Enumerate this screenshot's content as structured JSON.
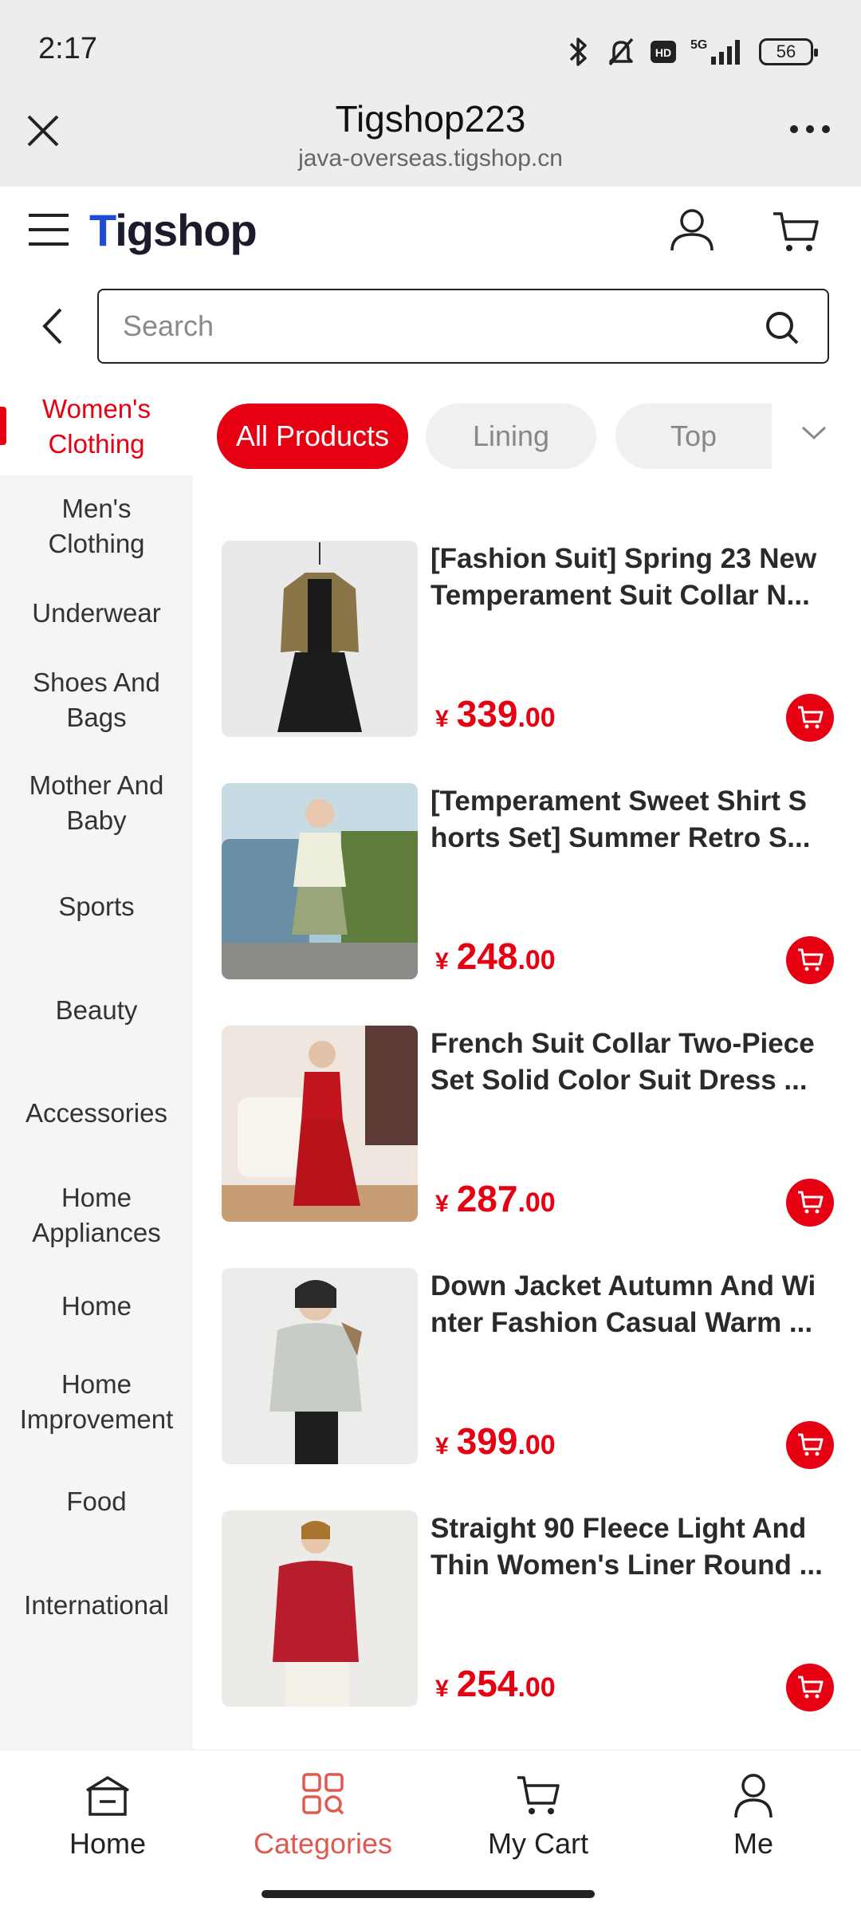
{
  "status_bar": {
    "time": "2:17",
    "network": "5G",
    "hd_badge": "HD",
    "battery": "56",
    "icons": [
      "bluetooth-icon",
      "mute-icon",
      "hd-icon",
      "signal-icon",
      "battery-icon"
    ]
  },
  "browser": {
    "title": "Tigshop223",
    "url": "java-overseas.tigshop.cn"
  },
  "header": {
    "logo": "Tigshop"
  },
  "search": {
    "placeholder": "Search"
  },
  "sidebar": {
    "items": [
      {
        "label": "Women's\nClothing",
        "active": true
      },
      {
        "label": "Men's\nClothing"
      },
      {
        "label": "Underwear"
      },
      {
        "label": "Shoes And\nBags"
      },
      {
        "label": "Mother And\nBaby"
      },
      {
        "label": "Sports"
      },
      {
        "label": "Beauty"
      },
      {
        "label": "Accessories"
      },
      {
        "label": "Home\nAppliances"
      },
      {
        "label": "Home"
      },
      {
        "label": "Home\nImprovement"
      },
      {
        "label": "Food"
      },
      {
        "label": "International"
      }
    ]
  },
  "filters": {
    "chips": [
      "All Products",
      "Lining",
      "Top"
    ],
    "active": "All Products"
  },
  "products": [
    {
      "title": "[Fashion Suit] Spring 23 New Temperament Suit Collar N...",
      "currency": "¥",
      "price_int": "339",
      "price_dec": ".00"
    },
    {
      "title": "[Temperament Sweet Shirt S horts Set] Summer Retro S...",
      "currency": "¥",
      "price_int": "248",
      "price_dec": ".00"
    },
    {
      "title": "French Suit Collar Two-Piece Set Solid Color Suit Dress ...",
      "currency": "¥",
      "price_int": "287",
      "price_dec": ".00"
    },
    {
      "title": "Down Jacket Autumn And Wi nter Fashion Casual Warm ...",
      "currency": "¥",
      "price_int": "399",
      "price_dec": ".00"
    },
    {
      "title": "Straight 90 Fleece Light And Thin Women's Liner Round ...",
      "currency": "¥",
      "price_int": "254",
      "price_dec": ".00"
    }
  ],
  "bottom_nav": {
    "items": [
      {
        "label": "Home",
        "icon": "home-icon"
      },
      {
        "label": "Categories",
        "icon": "categories-icon",
        "active": true
      },
      {
        "label": "My Cart",
        "icon": "cart-icon"
      },
      {
        "label": "Me",
        "icon": "user-icon"
      }
    ]
  },
  "colors": {
    "accent": "#e60012",
    "nav_active": "#e05a52"
  }
}
